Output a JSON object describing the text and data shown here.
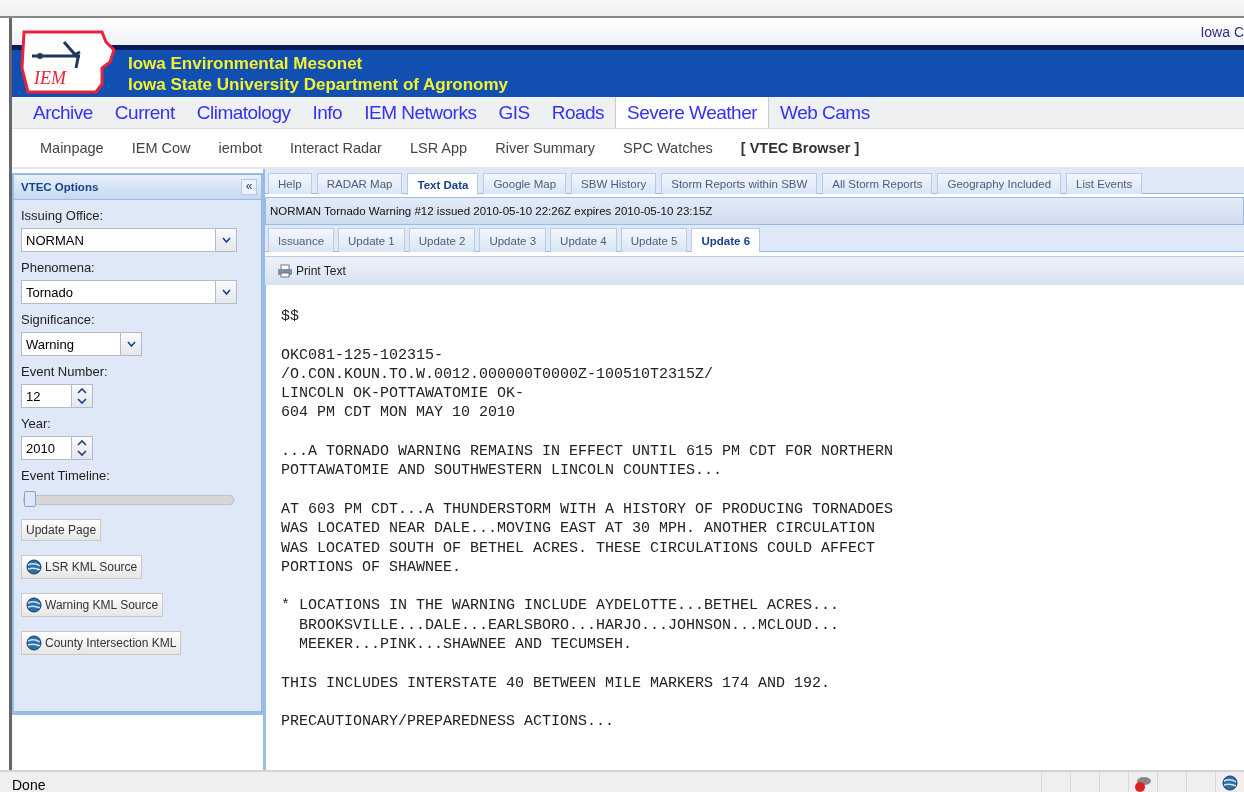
{
  "header": {
    "logo_text": "IEM",
    "site_title": "Iowa Environmental Mesonet",
    "site_subtitle": "Iowa State University Department of Agronomy",
    "top_right": "Iowa C"
  },
  "nav": [
    {
      "label": "Archive",
      "selected": false
    },
    {
      "label": "Current",
      "selected": false
    },
    {
      "label": "Climatology",
      "selected": false
    },
    {
      "label": "Info",
      "selected": false
    },
    {
      "label": "IEM Networks",
      "selected": false
    },
    {
      "label": "GIS",
      "selected": false
    },
    {
      "label": "Roads",
      "selected": false
    },
    {
      "label": "Severe Weather",
      "selected": true
    },
    {
      "label": "Web Cams",
      "selected": false
    }
  ],
  "subnav": [
    {
      "label": "Mainpage",
      "selected": false
    },
    {
      "label": "IEM Cow",
      "selected": false
    },
    {
      "label": "iembot",
      "selected": false
    },
    {
      "label": "Interact Radar",
      "selected": false
    },
    {
      "label": "LSR App",
      "selected": false
    },
    {
      "label": "River Summary",
      "selected": false
    },
    {
      "label": "SPC Watches",
      "selected": false
    },
    {
      "label": "[ VTEC Browser ]",
      "selected": true
    }
  ],
  "sidebar": {
    "title": "VTEC Options",
    "collapse_glyph": "«",
    "fields": [
      {
        "kind": "combo",
        "label": "Issuing Office:",
        "value": "NORMAN",
        "wide": true
      },
      {
        "kind": "combo",
        "label": "Phenomena:",
        "value": "Tornado",
        "wide": true
      },
      {
        "kind": "combo",
        "label": "Significance:",
        "value": "Warning",
        "wide": false
      },
      {
        "kind": "spinner",
        "label": "Event Number:",
        "value": "12"
      },
      {
        "kind": "spinner",
        "label": "Year:",
        "value": "2010"
      },
      {
        "kind": "slider",
        "label": "Event Timeline:",
        "level": 0
      }
    ],
    "buttons": [
      {
        "kind": "plain",
        "label": "Update Page"
      },
      {
        "kind": "globe",
        "label": "LSR KML Source"
      },
      {
        "kind": "globe",
        "label": "Warning KML Source"
      },
      {
        "kind": "globe",
        "label": "County Intersection KML"
      }
    ]
  },
  "main": {
    "tabs": [
      {
        "label": "Help",
        "selected": false
      },
      {
        "label": "RADAR Map",
        "selected": false
      },
      {
        "label": "Text Data",
        "selected": true
      },
      {
        "label": "Google Map",
        "selected": false
      },
      {
        "label": "SBW History",
        "selected": false
      },
      {
        "label": "Storm Reports within SBW",
        "selected": false
      },
      {
        "label": "All Storm Reports",
        "selected": false
      },
      {
        "label": "Geography Included",
        "selected": false
      },
      {
        "label": "List Events",
        "selected": false
      }
    ],
    "warning_title": "NORMAN Tornado Warning #12 issued 2010-05-10 22:26Z expires 2010-05-10 23:15Z",
    "update_tabs": [
      {
        "label": "Issuance",
        "selected": false
      },
      {
        "label": "Update 1",
        "selected": false
      },
      {
        "label": "Update 2",
        "selected": false
      },
      {
        "label": "Update 3",
        "selected": false
      },
      {
        "label": "Update 4",
        "selected": false
      },
      {
        "label": "Update 5",
        "selected": false
      },
      {
        "label": "Update 6",
        "selected": true
      }
    ],
    "toolbar_button": "Print Text",
    "bulletin": [
      [
        "$$"
      ],
      [
        "OKC081-125-102315-",
        "/O.CON.KOUN.TO.W.0012.000000T0000Z-100510T2315Z/",
        "LINCOLN OK-POTTAWATOMIE OK-",
        "604 PM CDT MON MAY 10 2010"
      ],
      [
        "...A TORNADO WARNING REMAINS IN EFFECT UNTIL 615 PM CDT FOR NORTHERN",
        "POTTAWATOMIE AND SOUTHWESTERN LINCOLN COUNTIES..."
      ],
      [
        "AT 603 PM CDT...A THUNDERSTORM WITH A HISTORY OF PRODUCING TORNADOES",
        "WAS LOCATED NEAR DALE...MOVING EAST AT 30 MPH. ANOTHER CIRCULATION",
        "WAS LOCATED SOUTH OF BETHEL ACRES. THESE CIRCULATIONS COULD AFFECT",
        "PORTIONS OF SHAWNEE."
      ],
      [
        "* LOCATIONS IN THE WARNING INCLUDE AYDELOTTE...BETHEL ACRES...",
        "  BROOKSVILLE...DALE...EARLSBORO...HARJO...JOHNSON...MCLOUD...",
        "  MEEKER...PINK...SHAWNEE AND TECUMSEH."
      ],
      [
        "THIS INCLUDES INTERSTATE 40 BETWEEN MILE MARKERS 174 AND 192."
      ],
      [
        "PRECAUTIONARY/PREPAREDNESS ACTIONS..."
      ]
    ]
  },
  "status_bar": {
    "text": "Done"
  }
}
